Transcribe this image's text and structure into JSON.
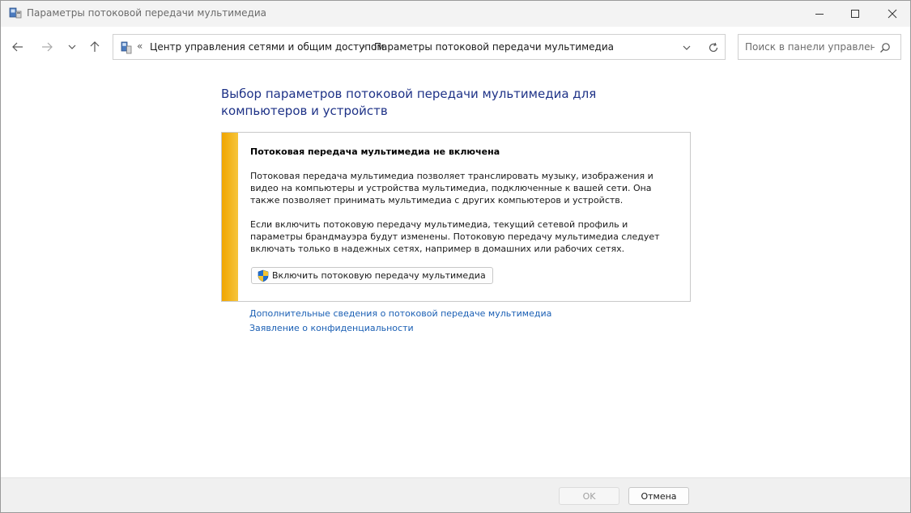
{
  "window": {
    "title": "Параметры потоковой передачи мультимедиа"
  },
  "address": {
    "crumb_prefix": "«",
    "crumbs": [
      "Центр управления сетями и общим доступом",
      "Параметры потоковой передачи мультимедиа"
    ],
    "separator": "›"
  },
  "search": {
    "placeholder": "Поиск в панели управления"
  },
  "main": {
    "heading": "Выбор параметров потоковой передачи мультимедиа для компьютеров и устройств",
    "panel": {
      "title": "Потоковая передача мультимедиа не включена",
      "paragraph1": "Потоковая передача мультимедиа позволяет транслировать музыку, изображения и видео на компьютеры и устройства мультимедиа, подключенные к вашей сети. Она также позволяет принимать мультимедиа с других компьютеров и устройств.",
      "paragraph2": "Если включить потоковую передачу мультимедиа, текущий сетевой профиль и параметры брандмауэра будут изменены. Потоковую передачу мультимедиа следует включать только в надежных сетях, например в домашних или рабочих сетях.",
      "enable_button": "Включить потоковую передачу мультимедиа"
    },
    "links": [
      "Дополнительные сведения о потоковой передаче мультимедиа",
      "Заявление о конфиденциальности"
    ]
  },
  "footer": {
    "ok_label": "OK",
    "cancel_label": "Отмена"
  },
  "colors": {
    "accent_stripe": "#f0a500",
    "heading": "#1e3287",
    "link": "#1a5fb4"
  }
}
